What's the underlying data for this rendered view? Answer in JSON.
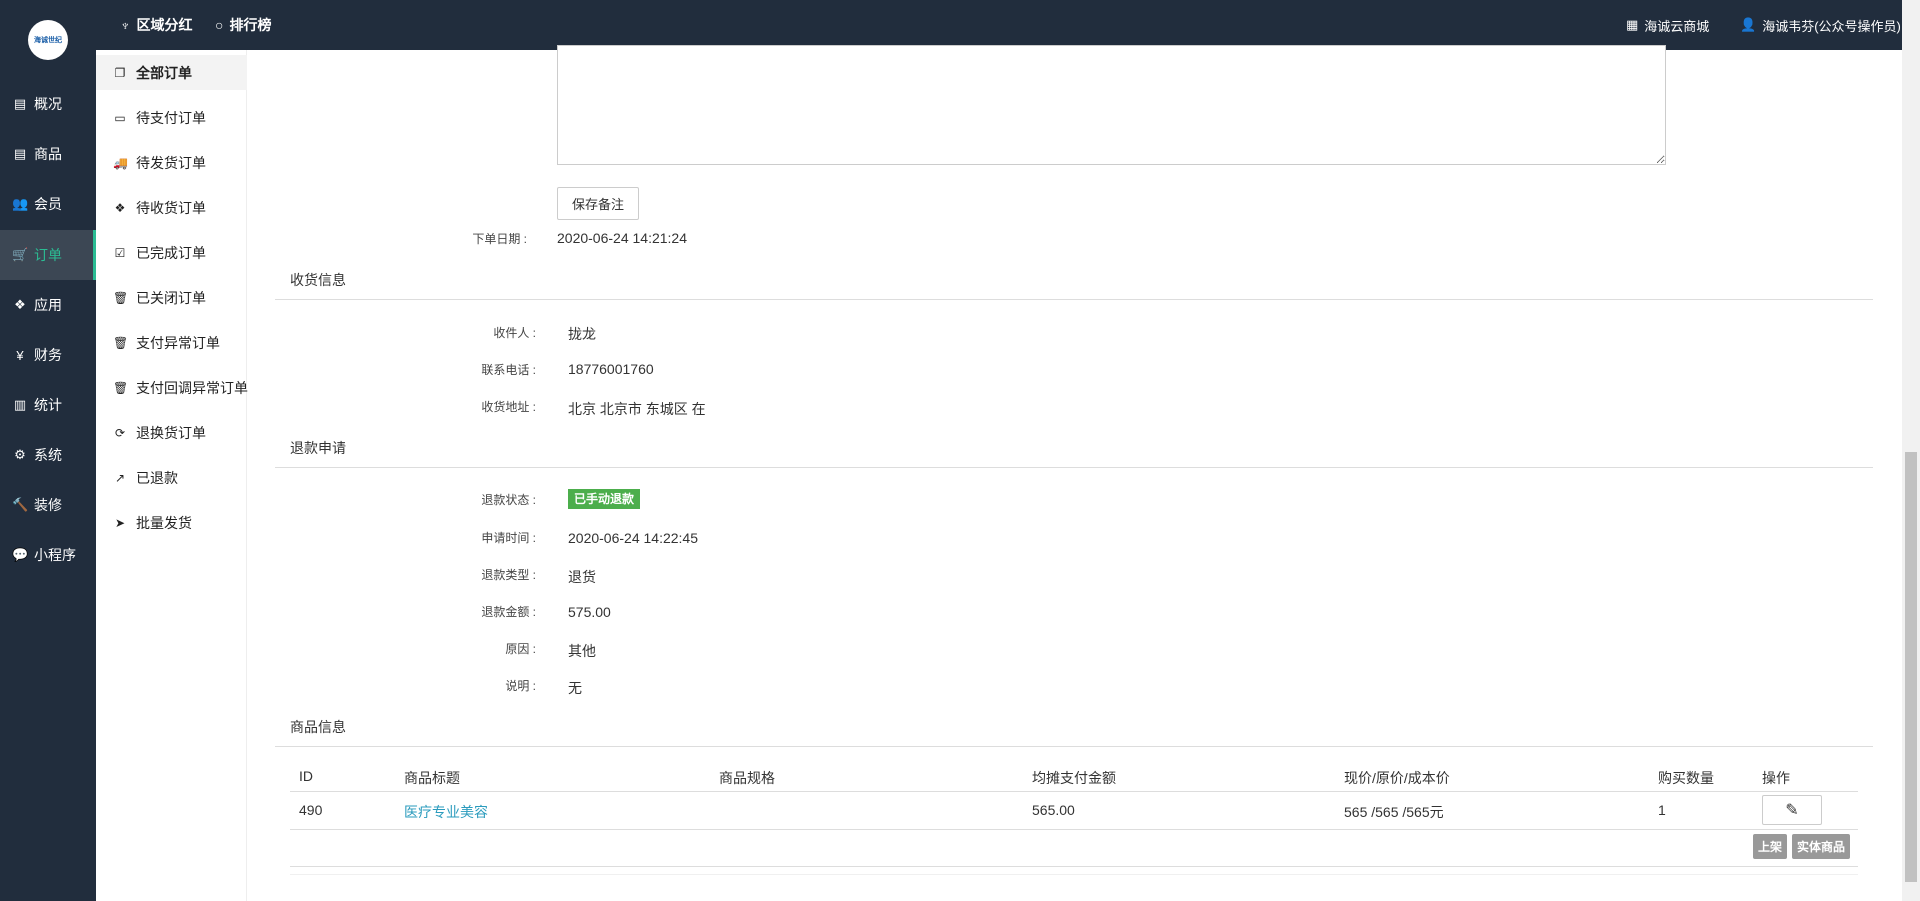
{
  "header": {
    "logo_text": "海诚世纪",
    "nav": [
      {
        "icon": "key-icon",
        "label": "区域分红"
      },
      {
        "icon": "circle-icon",
        "label": "排行榜"
      }
    ],
    "shop_label": "海诚云商城",
    "user_label": "海诚韦芬(公众号操作员)"
  },
  "sidebar": {
    "items": [
      {
        "label": "概况"
      },
      {
        "label": "商品"
      },
      {
        "label": "会员"
      },
      {
        "label": "订单"
      },
      {
        "label": "应用"
      },
      {
        "label": "财务"
      },
      {
        "label": "统计"
      },
      {
        "label": "系统"
      },
      {
        "label": "装修"
      },
      {
        "label": "小程序"
      }
    ]
  },
  "submenu": {
    "items": [
      {
        "label": "全部订单"
      },
      {
        "label": "待支付订单"
      },
      {
        "label": "待发货订单"
      },
      {
        "label": "待收货订单"
      },
      {
        "label": "已完成订单"
      },
      {
        "label": "已关闭订单"
      },
      {
        "label": "支付异常订单"
      },
      {
        "label": "支付回调异常订单"
      },
      {
        "label": "退换货订单"
      },
      {
        "label": "已退款"
      },
      {
        "label": "批量发货"
      }
    ]
  },
  "order": {
    "save_note_label": "保存备注",
    "order_date_label": "下单日期 :",
    "order_date": "2020-06-24 14:21:24"
  },
  "shipping": {
    "title": "收货信息",
    "rows": [
      {
        "label": "收件人 :",
        "value": "拢龙"
      },
      {
        "label": "联系电话 :",
        "value": "18776001760"
      },
      {
        "label": "收货地址 :",
        "value": "北京 北京市 东城区 在"
      }
    ]
  },
  "refund": {
    "title": "退款申请",
    "status_label": "退款状态 :",
    "status": "已手动退款",
    "status_color": "#4cae4c",
    "rows": [
      {
        "label": "申请时间 :",
        "value": "2020-06-24 14:22:45"
      },
      {
        "label": "退款类型 :",
        "value": "退货"
      },
      {
        "label": "退款金额 :",
        "value": "575.00"
      },
      {
        "label": "原因 :",
        "value": "其他"
      },
      {
        "label": "说明 :",
        "value": "无"
      }
    ]
  },
  "goods": {
    "title": "商品信息",
    "columns": [
      "ID",
      "商品标题",
      "商品规格",
      "均摊支付金额",
      "现价/原价/成本价",
      "购买数量",
      "操作"
    ],
    "rows": [
      {
        "id": "490",
        "title": "医疗专业美容",
        "spec": "",
        "paid": "565.00",
        "prices": "565 /565 /565元",
        "qty": "1"
      }
    ],
    "tag_shelf": "上架",
    "tag_type": "实体商品"
  }
}
